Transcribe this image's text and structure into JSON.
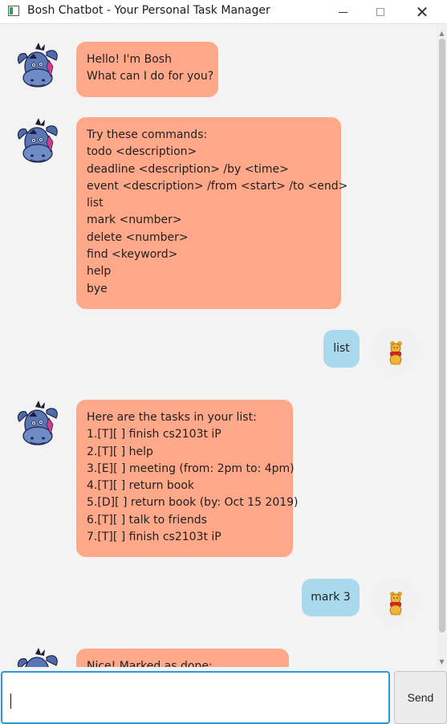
{
  "window": {
    "title": "Bosh Chatbot - Your Personal Task Manager",
    "icons": {
      "minimize": "minimize-icon",
      "maximize": "maximize-icon",
      "close": "close-icon",
      "app": "app-icon"
    }
  },
  "messages": [
    {
      "sender": "bot",
      "lines": [
        "Hello! I'm Bosh",
        "What can I do for you?"
      ]
    },
    {
      "sender": "bot",
      "lines": [
        "Try these commands:",
        "todo <description>",
        "deadline <description> /by <time>",
        "event <description> /from <start> /to <end>",
        "list",
        "mark <number>",
        "delete <number>",
        "find <keyword>",
        "help",
        "bye"
      ]
    },
    {
      "sender": "user",
      "text": "list"
    },
    {
      "sender": "bot",
      "lines": [
        "Here are the tasks in your list:",
        "1.[T][ ] finish cs2103t iP",
        "2.[T][ ] help",
        "3.[E][ ] meeting (from: 2pm to: 4pm)",
        "4.[T][ ] return book",
        "5.[D][ ] return book (by: Oct 15 2019)",
        "6.[T][ ] talk to friends",
        "7.[T][ ] finish cs2103t iP"
      ]
    },
    {
      "sender": "user",
      "text": "mark 3"
    },
    {
      "sender": "bot",
      "lines": [
        "Nice! Marked as done:"
      ]
    }
  ],
  "avatars": {
    "bot": "eeyore-avatar",
    "user": "pooh-avatar"
  },
  "input": {
    "value": "",
    "placeholder": ""
  },
  "send_label": "Send",
  "colors": {
    "bot_bubble": "#ffa88a",
    "user_bubble": "#a9d9ec",
    "input_focus": "#2c99d8"
  }
}
